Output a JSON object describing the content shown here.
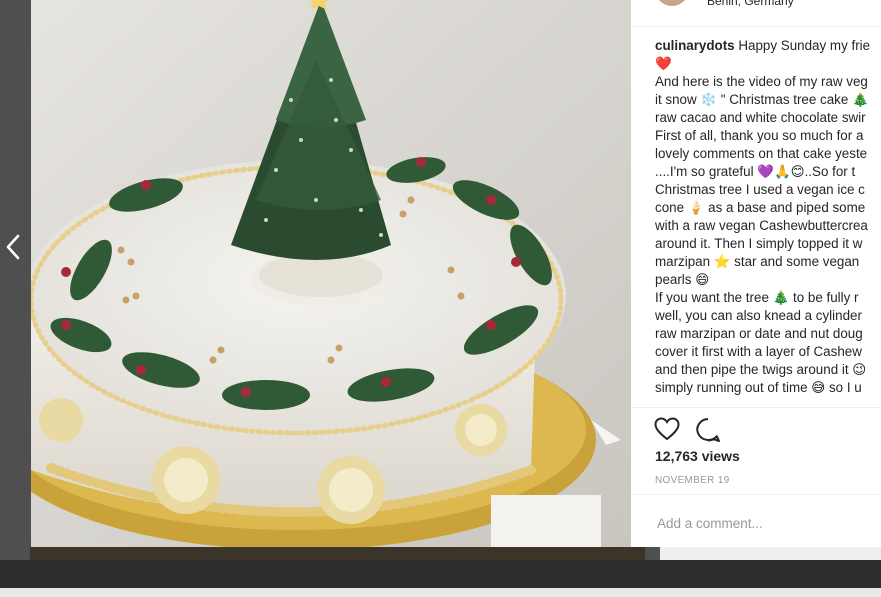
{
  "post": {
    "location": "Berlin, Germany",
    "username": "culinarydots",
    "caption_lines": [
      " Happy Sunday my frie",
      "❤️",
      "And here is the video of my raw veg",
      "it snow ❄️ \" Christmas tree cake 🎄",
      "raw cacao and white chocolate swir",
      "First of all, thank you so much for a",
      "lovely comments on that cake yeste",
      "....I'm so grateful 💜🙏😊..So for t",
      "Christmas tree I used a vegan ice c",
      "cone 🍦 as a base and piped some",
      "with a raw vegan Cashewbuttercrea",
      "around it. Then I simply topped it w",
      "marzipan ⭐ star and some vegan",
      "pearls 😄",
      "If you want the tree 🎄 to be fully r",
      "well, you can also knead a cylinder",
      "raw marzipan or date and nut doug",
      "cover it first with a layer of Cashew",
      "and then pipe the twigs around it 😉",
      "simply running out of time 😅 so I u"
    ],
    "views": "12,763 views",
    "date": "NOVEMBER 19",
    "comment_placeholder": "Add a comment..."
  },
  "icons": {
    "prev": "chevron-left-icon",
    "like": "heart-icon",
    "comment": "comment-bubble-icon"
  },
  "colors": {
    "panel_bg": "#ffffff",
    "backdrop": "#4f4f4f",
    "text": "#262626",
    "muted": "#999999"
  }
}
